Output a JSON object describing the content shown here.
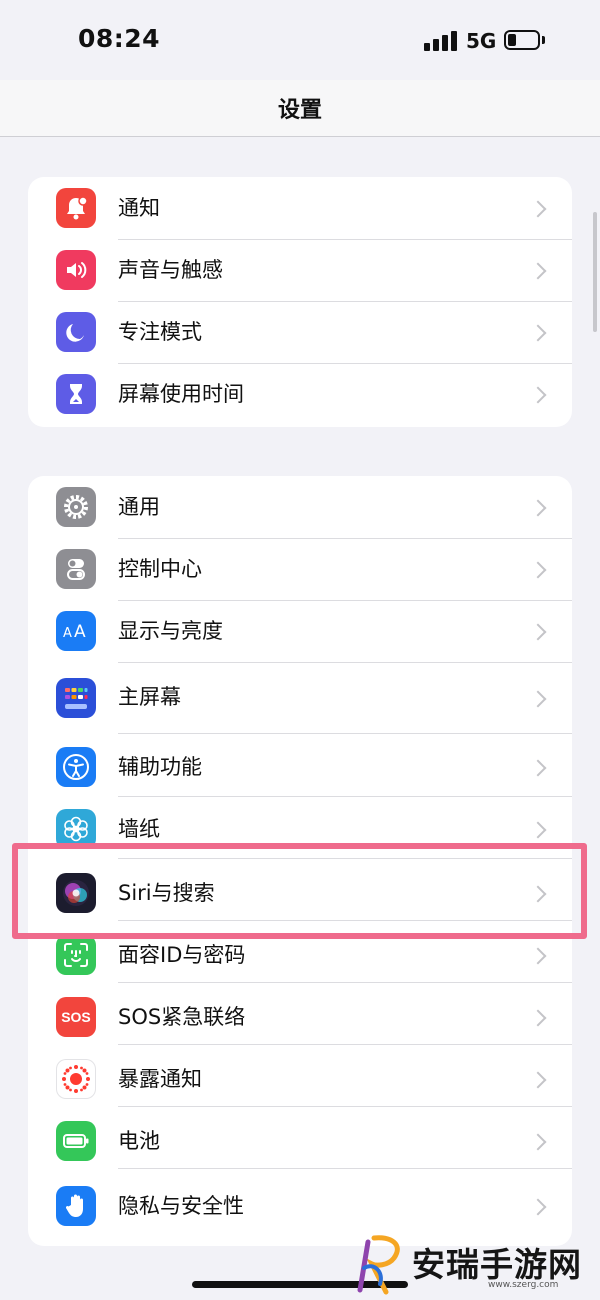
{
  "status_bar": {
    "time": "08:24",
    "network": "5G"
  },
  "nav": {
    "title": "设置"
  },
  "groups": [
    {
      "items": [
        {
          "label": "通知",
          "icon": "bell-icon",
          "color": "#f2453d"
        },
        {
          "label": "声音与触感",
          "icon": "speaker-icon",
          "color": "#f03a5f"
        },
        {
          "label": "专注模式",
          "icon": "moon-icon",
          "color": "#5e5ce6"
        },
        {
          "label": "屏幕使用时间",
          "icon": "hourglass-icon",
          "color": "#5e5ce6"
        }
      ]
    },
    {
      "items": [
        {
          "label": "通用",
          "icon": "gear-icon",
          "color": "#8e8e93"
        },
        {
          "label": "控制中心",
          "icon": "toggle-icon",
          "color": "#8e8e93"
        },
        {
          "label": "显示与亮度",
          "icon": "text-size-icon",
          "color": "#1a7cf5"
        },
        {
          "label": "主屏幕",
          "icon": "home-grid-icon",
          "color": "#2b4fd8"
        },
        {
          "label": "辅助功能",
          "icon": "accessibility-icon",
          "color": "#1a7cf5"
        },
        {
          "label": "墙纸",
          "icon": "flower-icon",
          "color": "#2fa8d8"
        },
        {
          "label": "Siri与搜索",
          "icon": "siri-icon",
          "color": "#1c1c2e"
        },
        {
          "label": "面容ID与密码",
          "icon": "face-id-icon",
          "color": "#34c759"
        },
        {
          "label": "SOS紧急联络",
          "icon": "sos-icon",
          "color": "#f2453d",
          "icon_text": "SOS"
        },
        {
          "label": "暴露通知",
          "icon": "exposure-icon",
          "color": "#ffffff"
        },
        {
          "label": "电池",
          "icon": "battery-icon",
          "color": "#34c759"
        },
        {
          "label": "隐私与安全性",
          "icon": "hand-icon",
          "color": "#1a7cf5"
        }
      ]
    }
  ],
  "watermark": {
    "text": "安瑞手游网",
    "url": "www.szerg.com"
  },
  "colors": {
    "highlight": "#ef6b8c",
    "background": "#f2f2f7"
  }
}
